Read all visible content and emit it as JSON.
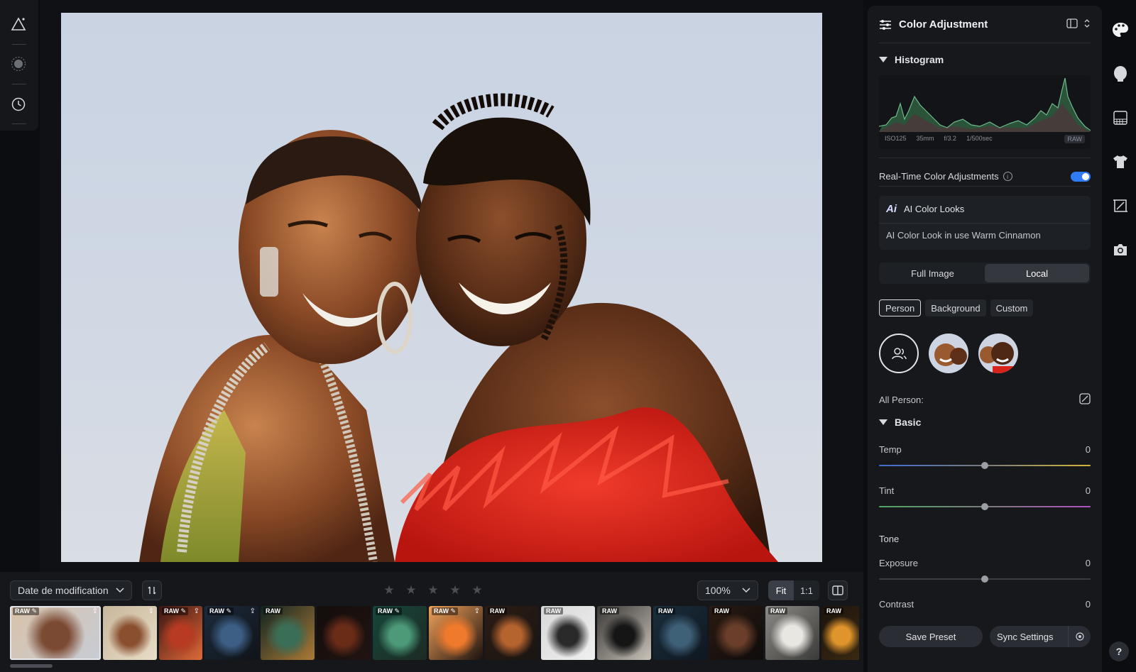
{
  "left_toolbar": {
    "tools": [
      {
        "icon": "ai-edit-icon"
      },
      {
        "icon": "brightness-icon"
      },
      {
        "icon": "history-icon"
      }
    ]
  },
  "bottom_bar": {
    "sort_label": "Date de modification",
    "zoom_value": "100%",
    "fit_label": "Fit",
    "one_to_one_label": "1:1",
    "rating_stars": 5,
    "rating_value": 0,
    "thumbnails": [
      {
        "tag": "RAW",
        "edited": true,
        "export": true,
        "selected": true,
        "colors": [
          "#d9c2a8",
          "#7b4a33",
          "#c7ccd6"
        ]
      },
      {
        "tag": "",
        "edited": false,
        "export": true,
        "selected": false,
        "colors": [
          "#c7b79b",
          "#8a4f2f",
          "#e9ddc8"
        ]
      },
      {
        "tag": "RAW",
        "edited": true,
        "export": true,
        "selected": false,
        "colors": [
          "#3a1410",
          "#b93a22",
          "#e06a3a"
        ]
      },
      {
        "tag": "RAW",
        "edited": true,
        "export": true,
        "selected": false,
        "colors": [
          "#1c2a3c",
          "#3d5f86",
          "#101418"
        ]
      },
      {
        "tag": "RAW",
        "edited": false,
        "export": false,
        "selected": false,
        "colors": [
          "#0f2422",
          "#3a6e57",
          "#ad7a36"
        ]
      },
      {
        "tag": "",
        "edited": false,
        "export": false,
        "selected": false,
        "colors": [
          "#130d0b",
          "#6b2c17",
          "#201412"
        ]
      },
      {
        "tag": "RAW",
        "edited": true,
        "export": false,
        "selected": false,
        "colors": [
          "#17463a",
          "#4c9a78",
          "#1c2b24"
        ]
      },
      {
        "tag": "RAW",
        "edited": true,
        "export": true,
        "selected": false,
        "colors": [
          "#f3a25a",
          "#f07a2c",
          "#1b1210"
        ]
      },
      {
        "tag": "RAW",
        "edited": false,
        "export": false,
        "selected": false,
        "colors": [
          "#2b1c14",
          "#b6642e",
          "#1a1512"
        ]
      },
      {
        "tag": "RAW",
        "edited": false,
        "export": false,
        "selected": false,
        "colors": [
          "#d8d8d8",
          "#2a2a2a",
          "#f0f0f0"
        ]
      },
      {
        "tag": "RAW",
        "edited": false,
        "export": false,
        "selected": false,
        "colors": [
          "#3a3836",
          "#151515",
          "#c8c2b8"
        ]
      },
      {
        "tag": "RAW",
        "edited": false,
        "export": false,
        "selected": false,
        "colors": [
          "#1a2e3c",
          "#3f6178",
          "#0f1720"
        ]
      },
      {
        "tag": "RAW",
        "edited": false,
        "export": false,
        "selected": false,
        "colors": [
          "#2a1a12",
          "#6a3e2a",
          "#0e0c0b"
        ]
      },
      {
        "tag": "RAW",
        "edited": false,
        "export": false,
        "selected": false,
        "colors": [
          "#8c8a86",
          "#e9e7e2",
          "#3a3a38"
        ]
      },
      {
        "tag": "RAW",
        "edited": false,
        "export": false,
        "selected": false,
        "colors": [
          "#1b140c",
          "#e0952c",
          "#3a2812"
        ]
      }
    ]
  },
  "panel": {
    "title": "Color Adjustment",
    "histogram": {
      "title": "Histogram",
      "meta": [
        "ISO125",
        "35mm",
        "f/3.2",
        "1/500sec"
      ],
      "raw_badge": "RAW"
    },
    "realtime_label": "Real-Time Color Adjustments",
    "realtime_info": "i",
    "realtime_on": true,
    "ai": {
      "logo": "Ai",
      "title": "AI Color Looks",
      "subtitle": "AI Color Look in use Warm Cinnamon"
    },
    "scope_tabs": [
      {
        "label": "Full Image",
        "active": false
      },
      {
        "label": "Local",
        "active": true
      }
    ],
    "target_chips": [
      {
        "label": "Person",
        "active": true
      },
      {
        "label": "Background",
        "active": false
      },
      {
        "label": "Custom",
        "active": false
      }
    ],
    "all_person_label": "All Person:",
    "basic_title": "Basic",
    "tone_label": "Tone",
    "sliders": [
      {
        "label": "Temp",
        "value": "0",
        "position": 0.5
      },
      {
        "label": "Tint",
        "value": "0",
        "position": 0.5
      },
      {
        "label": "Exposure",
        "value": "0",
        "position": 0.5
      },
      {
        "label": "Contrast",
        "value": "0",
        "position": 0.5
      }
    ],
    "save_preset": "Save Preset",
    "sync_settings": "Sync Settings"
  },
  "right_rail": {
    "icons": [
      "palette-icon",
      "face-icon",
      "checker-icon",
      "shirt-icon",
      "crop-icon",
      "camera-icon"
    ],
    "help_label": "?"
  },
  "colors": {
    "accent": "#2f7cf6",
    "panel_bg": "#16181c",
    "app_bg": "#0c0d10"
  }
}
